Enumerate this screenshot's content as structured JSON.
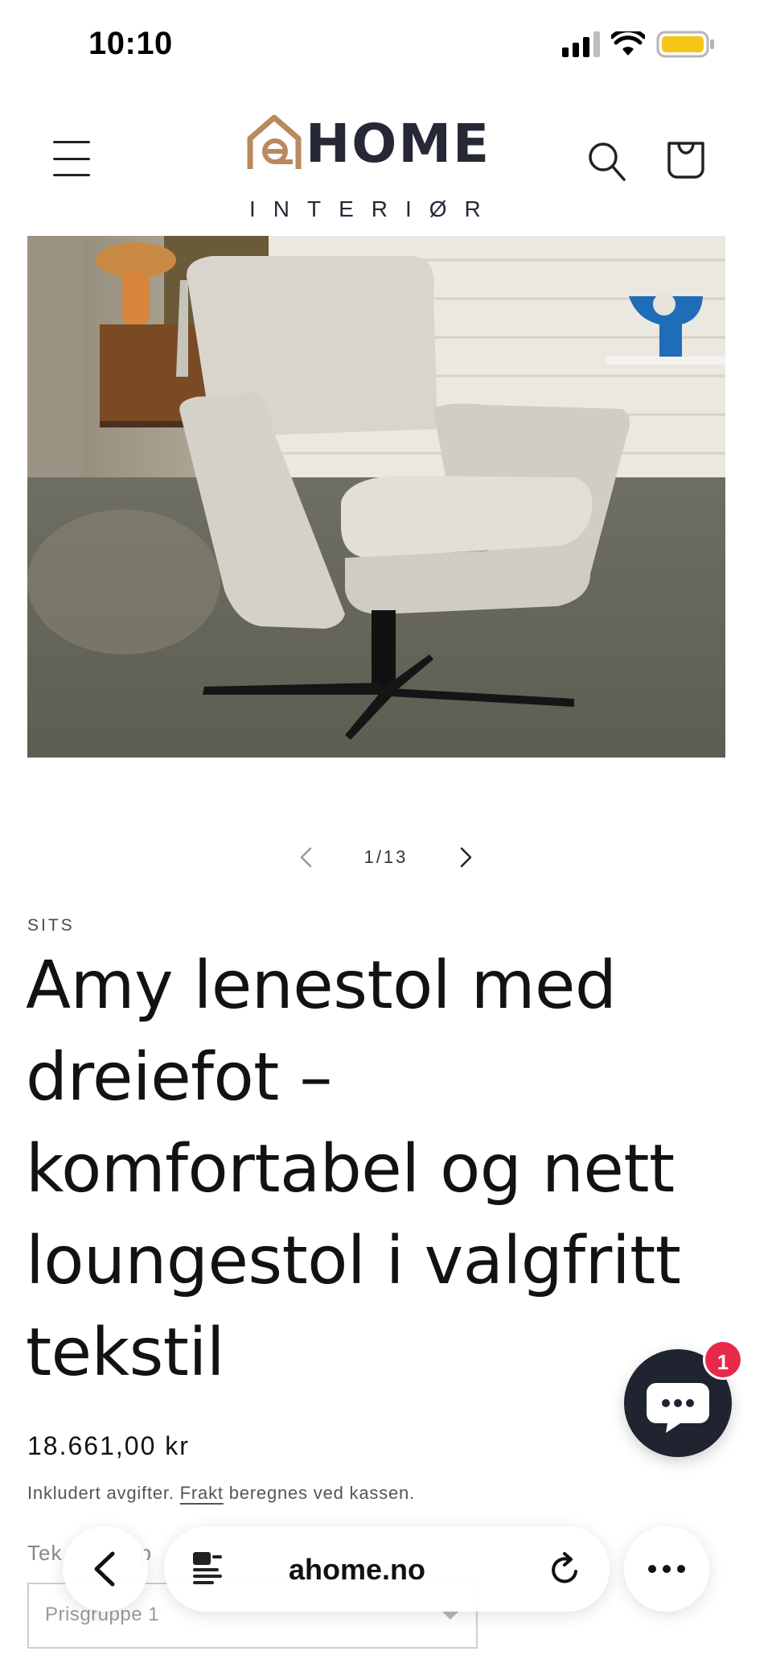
{
  "status_bar": {
    "time": "10:10",
    "icons": [
      "signal-icon",
      "wifi-icon",
      "battery-icon"
    ],
    "battery_color": "#f5c518"
  },
  "header": {
    "logo_word": "HOME",
    "logo_subtitle": "INTERIØR",
    "logo_accent_color": "#b88a5e",
    "logo_text_color": "#262836",
    "icons": [
      "menu-icon",
      "search-icon",
      "cart-icon"
    ]
  },
  "gallery": {
    "counter": "1/13",
    "prev_icon": "chevron-left-icon",
    "next_icon": "chevron-right-icon"
  },
  "product": {
    "vendor": "SITS",
    "title": "Amy lenestol med dreiefot – komfortabel og nett loungestol i valgfritt tekstil",
    "price": "18.661,00 kr",
    "tax_prefix": "Inkludert avgifter.",
    "shipping_link": "Frakt",
    "tax_suffix": "beregnes ved kassen.",
    "variant_label": "Tek",
    "variant_label_tail": "p",
    "variant_value": "Prisgruppe 1"
  },
  "chat": {
    "badge_count": "1",
    "icon": "chat-bubble-icon",
    "badge_color": "#e8294a"
  },
  "browser": {
    "url": "ahome.no",
    "icons": [
      "back-arrow-icon",
      "reader-icon",
      "reload-icon",
      "more-icon"
    ]
  }
}
